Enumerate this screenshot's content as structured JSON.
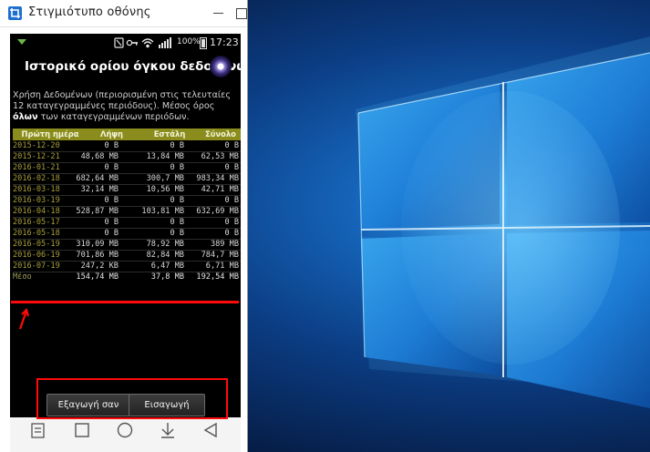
{
  "window": {
    "title": "Στιγμιότυπο οθόνης"
  },
  "statusbar": {
    "battery": "100%",
    "time": "17:23"
  },
  "app": {
    "title": "Ιστορικό ορίου όγκου δεδομένων",
    "description_prefix": "Χρήση Δεδομένων (περιορισμένη στις τελευταίες 12 καταγεγραμμένες περιόδους). Μέσος όρος ",
    "description_bold": "όλων",
    "description_suffix": " των καταγεγραμμένων περιόδων."
  },
  "table": {
    "headers": [
      "Πρώτη ημέρα",
      "Λήψη",
      "Εστάλη",
      "Σύνολο"
    ],
    "rows": [
      [
        "2015-12-20",
        "0 B",
        "0 B",
        "0 B"
      ],
      [
        "2015-12-21",
        "48,68 MB",
        "13,84 MB",
        "62,53 MB"
      ],
      [
        "2016-01-21",
        "0 B",
        "0 B",
        "0 B"
      ],
      [
        "2016-02-18",
        "682,64 MB",
        "300,7 MB",
        "983,34 MB"
      ],
      [
        "2016-03-18",
        "32,14 MB",
        "10,56 MB",
        "42,71 MB"
      ],
      [
        "2016-03-19",
        "0 B",
        "0 B",
        "0 B"
      ],
      [
        "2016-04-18",
        "528,87 MB",
        "103,81 MB",
        "632,69 MB"
      ],
      [
        "2016-05-17",
        "0 B",
        "0 B",
        "0 B"
      ],
      [
        "2016-05-18",
        "0 B",
        "0 B",
        "0 B"
      ],
      [
        "2016-05-19",
        "310,09 MB",
        "78,92 MB",
        "389 MB"
      ],
      [
        "2016-06-19",
        "701,86 MB",
        "82,84 MB",
        "784,7 MB"
      ],
      [
        "2016-07-19",
        "247,2 KB",
        "6,47 MB",
        "6,71 MB"
      ]
    ],
    "average": [
      "Μέσο",
      "154,74 MB",
      "37,8 MB",
      "192,54 MB"
    ]
  },
  "buttons": {
    "export": "Εξαγωγή σαν",
    "import": "Εισαγωγή"
  },
  "colors": {
    "annotation": "#ff0a0a",
    "table_header": "#8a8c1e",
    "date_text": "#a89e3a"
  },
  "icons": {
    "app": "crop-screenshot-icon",
    "nav": [
      "recents-icon",
      "square-icon",
      "home-circle-icon",
      "download-icon",
      "back-icon"
    ]
  }
}
